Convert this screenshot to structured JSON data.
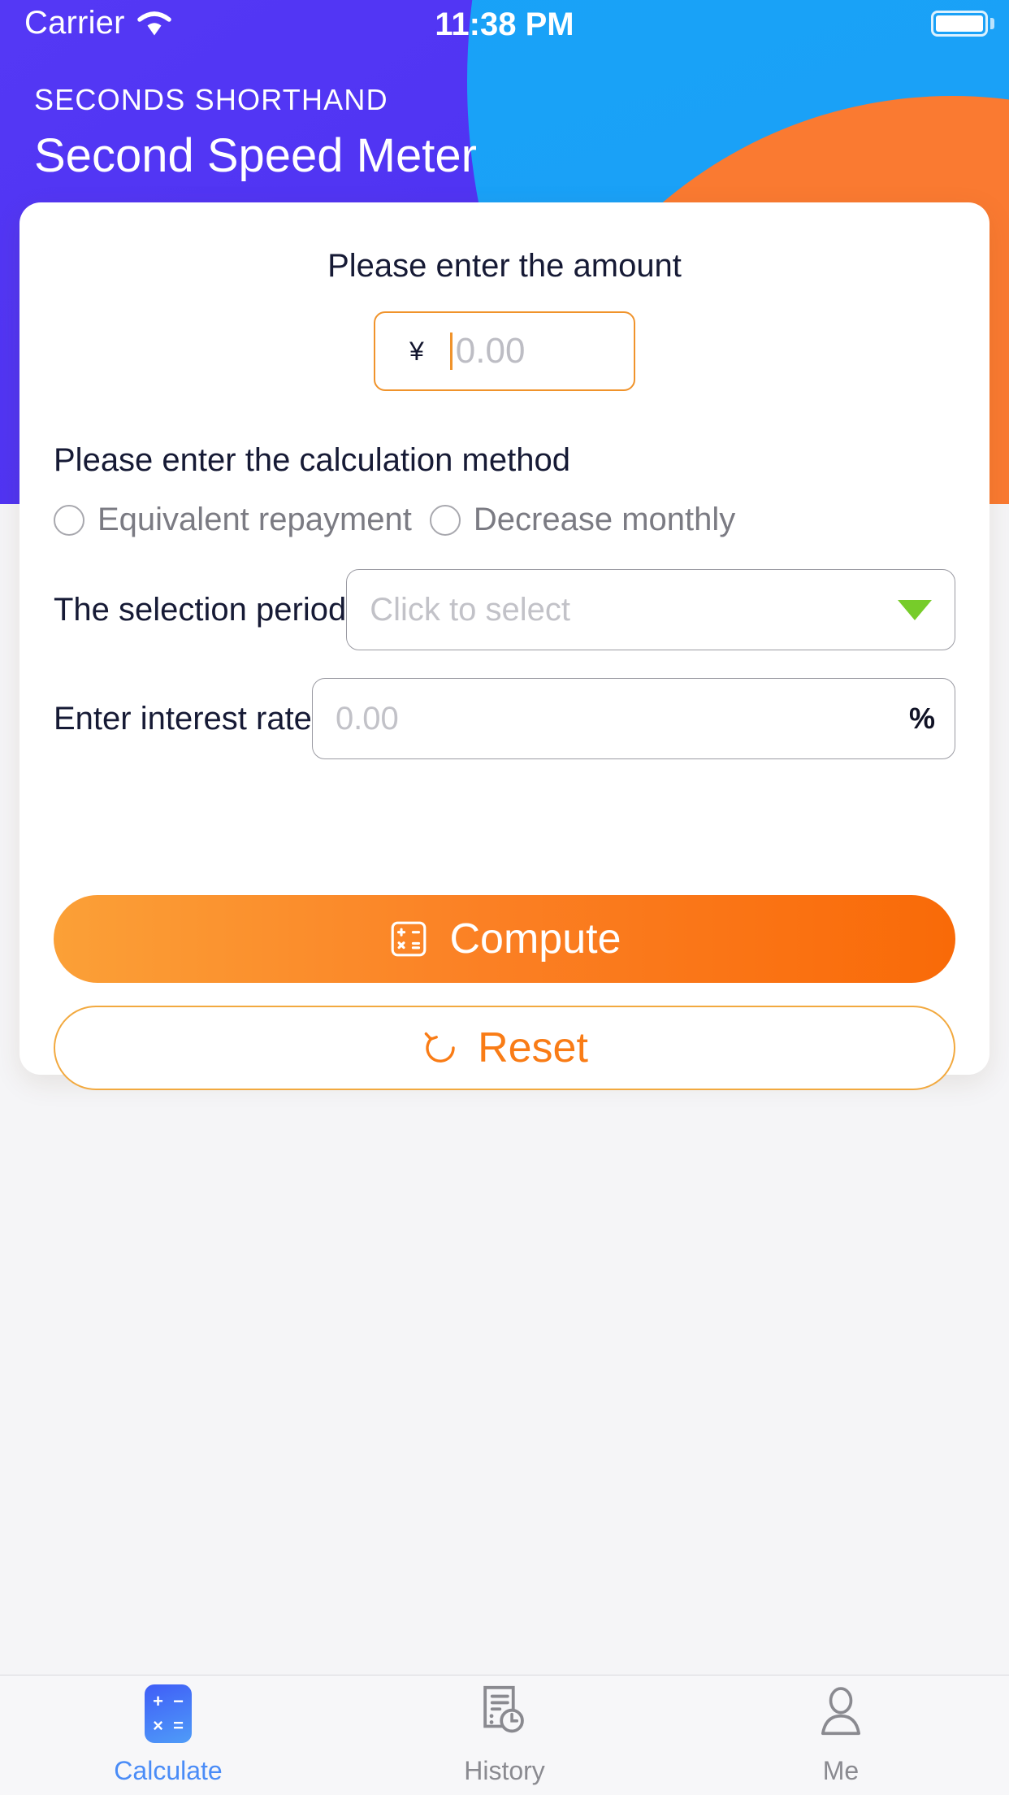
{
  "status_bar": {
    "carrier": "Carrier",
    "time": "11:38 PM",
    "wifi_icon": "wifi-icon",
    "battery_icon": "battery-icon"
  },
  "header": {
    "kicker": "SECONDS SHORTHAND",
    "title": "Second Speed Meter",
    "purple": "#5438f5",
    "blue": "#1e9bf6",
    "orange": "#fa7a31"
  },
  "form": {
    "amount_label": "Please enter the amount",
    "currency_symbol": "¥",
    "amount_placeholder": "0.00",
    "amount_value": "",
    "method_label": "Please enter the calculation method",
    "methods": [
      {
        "label": "Equivalent repayment",
        "selected": false
      },
      {
        "label": "Decrease monthly",
        "selected": false
      }
    ],
    "period_label": "The selection period",
    "period_placeholder": "Click to select",
    "period_value": "",
    "rate_label": "Enter interest rate",
    "rate_placeholder": "0.00",
    "rate_value": "",
    "rate_unit": "%",
    "dropdown_arrow_color": "#77cc2a",
    "accent_orange": "#f0932b"
  },
  "actions": {
    "compute_label": "Compute",
    "compute_icon": "calculator-icon",
    "reset_label": "Reset",
    "reset_icon": "refresh-ccw-icon"
  },
  "tabbar": {
    "items": [
      {
        "label": "Calculate",
        "icon": "calculator-icon",
        "active": true
      },
      {
        "label": "History",
        "icon": "document-clock-icon",
        "active": false
      },
      {
        "label": "Me",
        "icon": "person-icon",
        "active": false
      }
    ],
    "active_color": "#4a8cf7",
    "inactive_color": "#8a8a90"
  }
}
